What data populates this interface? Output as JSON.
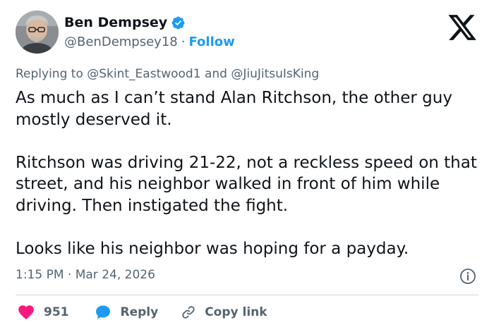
{
  "author": {
    "name": "Ben Dempsey",
    "handle": "@BenDempsey18",
    "separator": "·",
    "follow_label": "Follow",
    "verified": true,
    "verified_color": "#1d9bf0"
  },
  "reply_context": {
    "prefix": "Replying to ",
    "mention_1": "@Skint_Eastwood1",
    "conjunction": " and ",
    "mention_2": "@JiuJitsuIsKing"
  },
  "tweet": {
    "paragraphs": [
      "As much as I can’t stand Alan Ritchson, the other guy mostly deserved it.",
      "Ritchson was driving 21-22, not a reckless speed on that street, and his neighbor walked in front of him while driving.  Then instigated the fight.",
      "Looks like his neighbor was hoping for a payday."
    ],
    "timestamp": "1:15 PM · Mar 24, 2026"
  },
  "actions": {
    "like_count": "951",
    "like_color": "#f91880",
    "reply_label": "Reply",
    "reply_color": "#1d9bf0",
    "copy_label": "Copy link"
  },
  "icons": {
    "brand": "x-logo-icon",
    "info": "info-icon",
    "like": "heart-icon",
    "reply": "reply-bubble-icon",
    "copy": "link-icon"
  }
}
